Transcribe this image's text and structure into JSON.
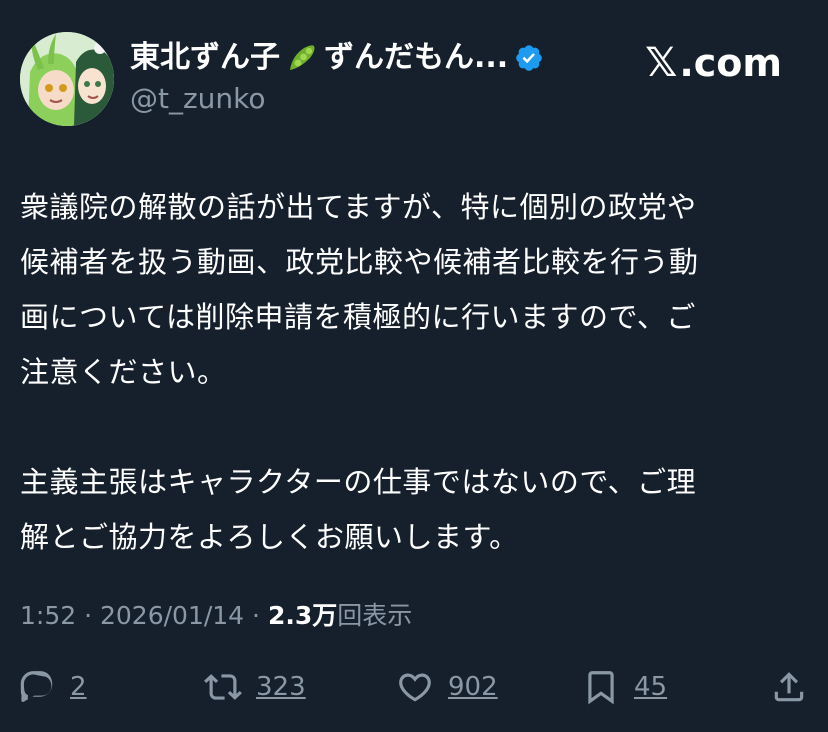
{
  "header": {
    "display_name": "東北ずん子",
    "display_name_suffix": "ずんだもん...",
    "handle": "@t_zunko",
    "brand_x": "𝕏",
    "brand_rest": ".com",
    "icons": [
      "edamame-icon",
      "verified-badge-icon"
    ]
  },
  "tweet": {
    "paragraph1": "衆議院の解散の話が出てますが、特に個別の政党や\n候補者を扱う動画、政党比較や候補者比較を行う動\n画については削除申請を積極的に行いますので、ご\n注意ください。",
    "paragraph2": "主義主張はキャラクターの仕事ではないので、ご理\n解とご協力をよろしくお願いします。"
  },
  "meta": {
    "time": "1:52",
    "separator": "·",
    "date": "2026/01/14",
    "views_count": "2.3万",
    "views_label": "回表示"
  },
  "actions": {
    "replies": "2",
    "reposts": "323",
    "likes": "902",
    "bookmarks": "45",
    "icons": [
      "reply-icon",
      "repost-icon",
      "like-icon",
      "bookmark-icon",
      "share-icon"
    ]
  },
  "colors": {
    "background": "#16202c",
    "muted_text": "#8a98a6",
    "verified": "#1d9bf0"
  }
}
